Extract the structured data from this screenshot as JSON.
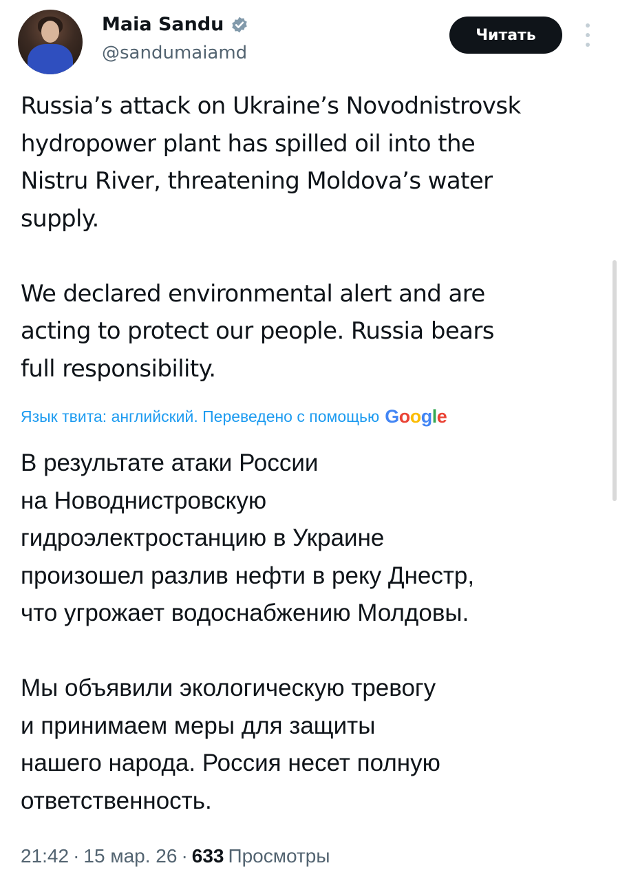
{
  "author": {
    "name": "Maia Sandu",
    "handle": "@sandumaiamd",
    "verified": true,
    "verified_color": "#829aab"
  },
  "follow_button": {
    "label": "Читать"
  },
  "tweet": {
    "paragraphs": [
      "Russia’s attack on Ukraine’s Novodnistrovsk\nhydropower plant has spilled oil into the\nNistru River, threatening Moldova’s water\nsupply.",
      "We declared environmental alert and are\nacting to protect our people. Russia bears\nfull responsibility."
    ]
  },
  "translation": {
    "notice": "Язык твита: английский. Переведено с помощью",
    "provider": "Google",
    "paragraphs": [
      "В результате атаки России\nна Новоднистровскую\nгидроэлектростанцию в Украине\nпроизошел разлив нефти в реку Днестр,\nчто угрожает водоснабжению Молдовы.",
      "Мы объявили экологическую тревогу\nи принимаем меры для защиты\nнашего народа. Россия несет полную\nответственность."
    ]
  },
  "meta": {
    "time": "21:42",
    "date": "15 мар. 26",
    "views_count": "633",
    "views_label": "Просмотры",
    "separator": "·"
  },
  "colors": {
    "link": "#1d9bf0",
    "secondary_text": "#536471",
    "primary_text": "#0f1419",
    "button_bg": "#0f1419"
  },
  "icons": {
    "verified": "verified-badge-icon",
    "more": "more-vertical-icon"
  }
}
